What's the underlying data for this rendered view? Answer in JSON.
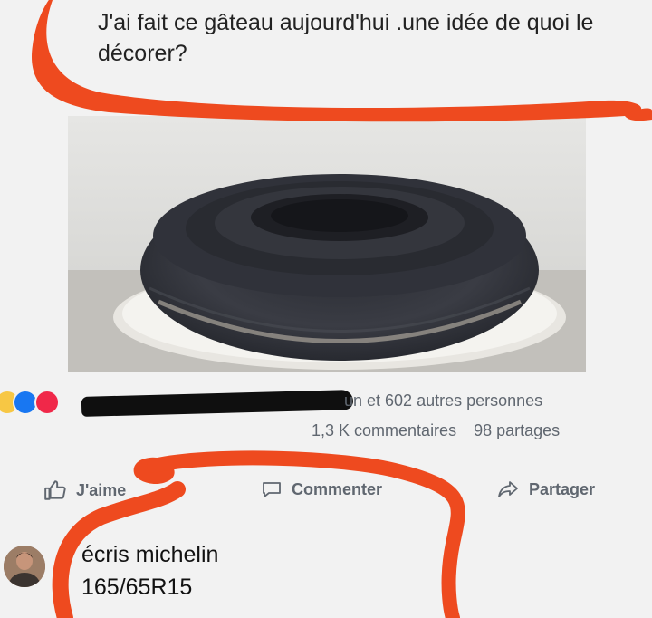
{
  "post": {
    "text": "J'ai fait ce gâteau aujourd'hui .une idée de quoi le décorer?",
    "photo_subject": "tire-shaped cake on a plate"
  },
  "engagement": {
    "reactors_text": "un et 602 autres personnes",
    "comments_count": "1,3 K commentaires",
    "shares_count": "98 partages"
  },
  "actions": {
    "like": "J'aime",
    "comment": "Commenter",
    "share": "Partager"
  },
  "comment": {
    "text": "écris michelin\n165/65R15"
  },
  "colors": {
    "scribble": "#ee4a1f",
    "like_blue": "#1877f2",
    "love_red": "#f02849",
    "haha_yellow": "#f7c744"
  },
  "icons": [
    "haha-reaction-icon",
    "like-reaction-icon",
    "love-reaction-icon",
    "thumbs-up-icon",
    "comment-icon",
    "share-icon"
  ]
}
